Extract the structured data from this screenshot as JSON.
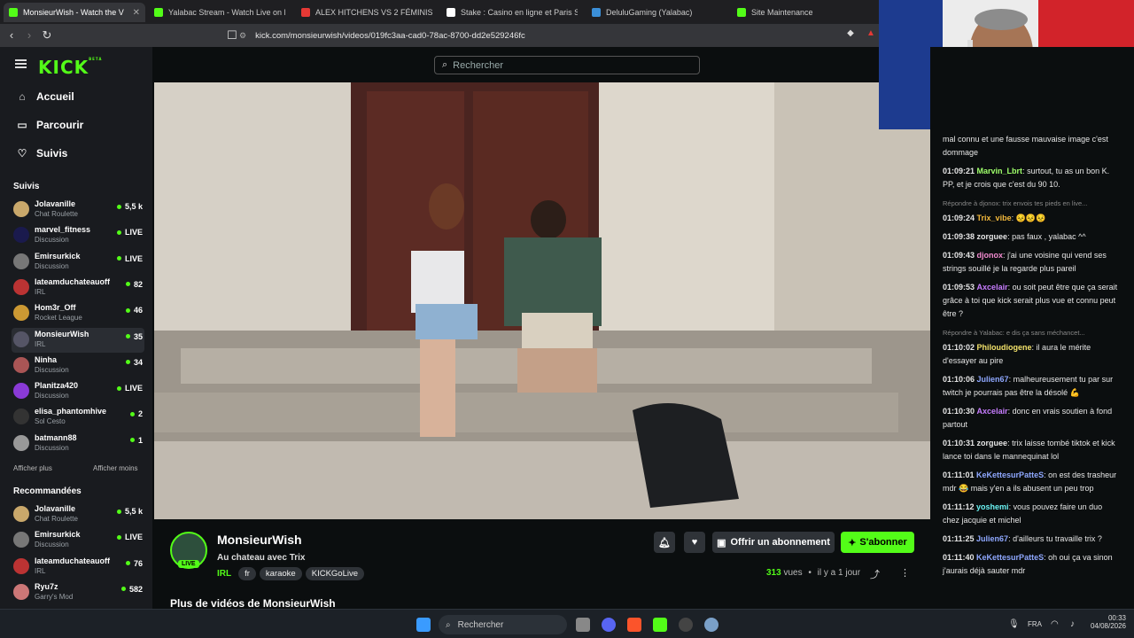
{
  "browser": {
    "tabs": [
      {
        "title": "MonsieurWish - Watch the V",
        "color": "#53fc18"
      },
      {
        "title": "Yalabac Stream - Watch Live on Kick",
        "color": "#53fc18"
      },
      {
        "title": "ALEX HITCHENS VS 2 FÉMINISTES !",
        "color": "#e53935"
      },
      {
        "title": "Stake : Casino en ligne et Paris Sports",
        "color": "#ffffff"
      },
      {
        "title": "DeluluGaming (Yalabac)",
        "color": "#3b8fd8"
      },
      {
        "title": "Site Maintenance",
        "color": "#53fc18"
      }
    ],
    "url": "kick.com/monsieurwish/videos/019fc3aa-cad0-78ac-8700-dd2e529246fc"
  },
  "header": {
    "logo": "KICK",
    "logo_sup": "BETA",
    "search_placeholder": "Rechercher"
  },
  "nav": {
    "home": "Accueil",
    "browse": "Parcourir",
    "following": "Suivis"
  },
  "sidebar": {
    "following_title": "Suivis",
    "following": [
      {
        "name": "Jolavanille",
        "category": "Chat Roulette",
        "viewers": "5,5 k",
        "color": "#c9a86b"
      },
      {
        "name": "marvel_fitness",
        "category": "Discussion",
        "viewers": "LIVE",
        "color": "#1a1a4d"
      },
      {
        "name": "Emirsurkick",
        "category": "Discussion",
        "viewers": "LIVE",
        "color": "#777"
      },
      {
        "name": "lateamduchateauoff",
        "category": "IRL",
        "viewers": "82",
        "color": "#b33"
      },
      {
        "name": "Hom3r_Off",
        "category": "Rocket League",
        "viewers": "46",
        "color": "#cc9933"
      },
      {
        "name": "MonsieurWish",
        "category": "IRL",
        "viewers": "35",
        "color": "#556"
      },
      {
        "name": "Ninha",
        "category": "Discussion",
        "viewers": "34",
        "color": "#a55"
      },
      {
        "name": "Planitza420",
        "category": "Discussion",
        "viewers": "LIVE",
        "color": "#8a3ad6"
      },
      {
        "name": "elisa_phantomhive",
        "category": "Sol Cesto",
        "viewers": "2",
        "color": "#333"
      },
      {
        "name": "batmann88",
        "category": "Discussion",
        "viewers": "1",
        "color": "#999"
      }
    ],
    "show_more": "Afficher plus",
    "show_less": "Afficher moins",
    "recommended_title": "Recommandées",
    "recommended": [
      {
        "name": "Jolavanille",
        "category": "Chat Roulette",
        "viewers": "5,5 k",
        "color": "#c9a86b"
      },
      {
        "name": "Emirsurkick",
        "category": "Discussion",
        "viewers": "LIVE",
        "color": "#777"
      },
      {
        "name": "lateamduchateauoff",
        "category": "IRL",
        "viewers": "76",
        "color": "#b33"
      },
      {
        "name": "Ryu7z",
        "category": "Garry's Mod",
        "viewers": "582",
        "color": "#c77"
      }
    ]
  },
  "video_info": {
    "channel": "MonsieurWish",
    "title": "Au chateau avec Trix",
    "live_badge": "LIVE",
    "tags": [
      "IRL",
      "fr",
      "karaoke",
      "KICKGoLive"
    ],
    "gift_button": "Offrir un abonnement",
    "subscribe_button": "S'abonner",
    "views": "313",
    "views_label": "vues",
    "age": "il y a 1 jour",
    "more_videos": "Plus de vidéos de MonsieurWish"
  },
  "chat": [
    {
      "reply": "",
      "time": "",
      "user": "",
      "color": "#e6e6e6",
      "text": "mal connu et une fausse mauvaise image c'est dommage"
    },
    {
      "reply": "",
      "time": "01:09:21",
      "user": "Marvin_Lbrt",
      "color": "#9fff6b",
      "text": "surtout, tu as un bon K. PP, et je crois que c'est du 90 10."
    },
    {
      "reply": "Répondre à djonox: trix envois tes pieds en live...",
      "time": "01:09:24",
      "user": "Trix_vibe",
      "color": "#f3b93c",
      "text": "😣😣😣"
    },
    {
      "reply": "",
      "time": "01:09:38",
      "user": "zorguee",
      "color": "#e6e6e6",
      "text": "pas faux , yalabac ^^"
    },
    {
      "reply": "",
      "time": "01:09:43",
      "user": "djonox",
      "color": "#f38bd0",
      "text": "j'ai une voisine qui vend ses strings souillé je la regarde plus pareil"
    },
    {
      "reply": "",
      "time": "01:09:53",
      "user": "Axcelair",
      "color": "#c77dff",
      "text": "ou soit peut être que ça serait grâce à toi que kick serait plus vue et connu peut être ?"
    },
    {
      "reply": "Répondre à Yalabac: e dis ça sans méchancet...",
      "time": "01:10:02",
      "user": "Philoudiogene",
      "color": "#f3e26b",
      "text": "il aura le mérite d'essayer au pire"
    },
    {
      "reply": "",
      "time": "01:10:06",
      "user": "Julien67",
      "color": "#8fa8ff",
      "text": "malheureusement tu par sur twitch je pourrais pas être la désolé 💪"
    },
    {
      "reply": "",
      "time": "01:10:30",
      "user": "Axcelair",
      "color": "#c77dff",
      "text": "donc en vrais soutien à fond partout"
    },
    {
      "reply": "",
      "time": "01:10:31",
      "user": "zorguee",
      "color": "#e6e6e6",
      "text": "trix laisse tombé tiktok et kick lance toi dans le mannequinat lol"
    },
    {
      "reply": "",
      "time": "01:11:01",
      "user": "KeKettesurPatteS",
      "color": "#8fa8ff",
      "text": "on est des trasheur mdr 😂 mais y'en a ils abusent un peu trop"
    },
    {
      "reply": "",
      "time": "01:11:12",
      "user": "yoshemi",
      "color": "#6bf3f3",
      "text": "vous pouvez faire un duo chez jacquie et michel"
    },
    {
      "reply": "",
      "time": "01:11:25",
      "user": "Julien67",
      "color": "#8fa8ff",
      "text": "d'ailleurs tu travaille trix ?"
    },
    {
      "reply": "",
      "time": "01:11:40",
      "user": "KeKettesurPatteS",
      "color": "#8fa8ff",
      "text": "oh oui ça va sinon j'aurais déjà sauter mdr"
    }
  ],
  "taskbar": {
    "search": "Rechercher",
    "lang": "FRA",
    "time": "00:33",
    "date": "04/08/2026"
  },
  "colors": {
    "accent": "#53fc18",
    "bg": "#0b0e0f",
    "sidebar": "#191b1f"
  }
}
